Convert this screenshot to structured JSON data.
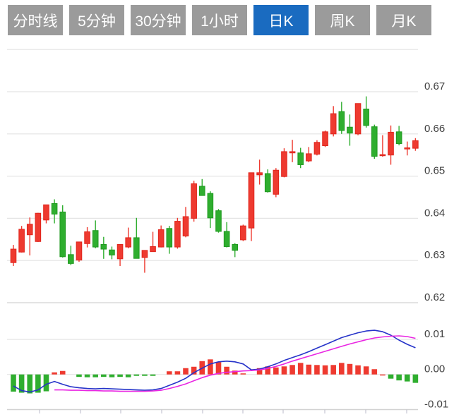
{
  "toolbar": {
    "tabs": [
      {
        "label": "分时线",
        "active": false
      },
      {
        "label": "5分钟",
        "active": false
      },
      {
        "label": "30分钟",
        "active": false
      },
      {
        "label": "1小时",
        "active": false
      },
      {
        "label": "日K",
        "active": true
      },
      {
        "label": "周K",
        "active": false
      },
      {
        "label": "月K",
        "active": false
      }
    ]
  },
  "colors": {
    "up": "#ee3a30",
    "up_border": "#e0251c",
    "down": "#2fae2f",
    "down_border": "#1f9a1f",
    "dif_line": "#2633c9",
    "dea_line": "#e926e2",
    "grid": "#e4e4e4",
    "pane_border": "#d2d2d2",
    "axis_text": "#3f3f3f",
    "tab_bg": "#9b9b9b",
    "tab_active_bg": "#1a6bc0",
    "tab_text": "#ffffff"
  },
  "chart_data": {
    "type": "candlestick+macd",
    "main_chart": {
      "ylabel": "price",
      "ylim": [
        0.618,
        0.68
      ],
      "y_axis_labels": [
        "0.67",
        "0.66",
        "0.65",
        "0.64",
        "0.63",
        "0.62"
      ],
      "y_axis_values": [
        0.67,
        0.66,
        0.65,
        0.64,
        0.63,
        0.62
      ],
      "grid_values_unlabeled": [
        0.68
      ],
      "candles_ochl": [
        [
          0.6295,
          0.6327,
          0.6337,
          0.6287
        ],
        [
          0.632,
          0.6374,
          0.6382,
          0.6319
        ],
        [
          0.6361,
          0.6386,
          0.6402,
          0.6312
        ],
        [
          0.6345,
          0.6412,
          0.6413,
          0.6344
        ],
        [
          0.6396,
          0.6432,
          0.6432,
          0.6388
        ],
        [
          0.6435,
          0.641,
          0.6445,
          0.6388
        ],
        [
          0.6415,
          0.6309,
          0.6431,
          0.6307
        ],
        [
          0.6314,
          0.6293,
          0.6335,
          0.6289
        ],
        [
          0.6301,
          0.6344,
          0.6344,
          0.6297
        ],
        [
          0.634,
          0.6368,
          0.6379,
          0.6331
        ],
        [
          0.6371,
          0.6332,
          0.6395,
          0.6329
        ],
        [
          0.6338,
          0.6327,
          0.6356,
          0.6304
        ],
        [
          0.6325,
          0.6313,
          0.6333,
          0.6303
        ],
        [
          0.6304,
          0.6338,
          0.6338,
          0.6287
        ],
        [
          0.6332,
          0.6354,
          0.6378,
          0.6329
        ],
        [
          0.6354,
          0.6305,
          0.6401,
          0.6305
        ],
        [
          0.6307,
          0.6324,
          0.6324,
          0.6271
        ],
        [
          0.6321,
          0.6333,
          0.6368,
          0.6321
        ],
        [
          0.6332,
          0.6373,
          0.6383,
          0.6331
        ],
        [
          0.6376,
          0.6332,
          0.6382,
          0.6316
        ],
        [
          0.6332,
          0.6393,
          0.6401,
          0.6328
        ],
        [
          0.6358,
          0.6404,
          0.6427,
          0.6355
        ],
        [
          0.64,
          0.6482,
          0.6489,
          0.6392
        ],
        [
          0.6476,
          0.6454,
          0.6493,
          0.6454
        ],
        [
          0.6459,
          0.6401,
          0.6464,
          0.6377
        ],
        [
          0.6418,
          0.6369,
          0.6422,
          0.6366
        ],
        [
          0.6369,
          0.6333,
          0.6391,
          0.6331
        ],
        [
          0.6338,
          0.6324,
          0.6341,
          0.6308
        ],
        [
          0.6349,
          0.6382,
          0.6385,
          0.6346
        ],
        [
          0.6377,
          0.6508,
          0.6508,
          0.6346
        ],
        [
          0.6503,
          0.6508,
          0.6539,
          0.648
        ],
        [
          0.6506,
          0.6463,
          0.6516,
          0.6461
        ],
        [
          0.6457,
          0.6514,
          0.6519,
          0.645
        ],
        [
          0.6499,
          0.6558,
          0.6566,
          0.6497
        ],
        [
          0.6555,
          0.6558,
          0.6586,
          0.6533
        ],
        [
          0.6555,
          0.6527,
          0.6567,
          0.6519
        ],
        [
          0.6536,
          0.6553,
          0.6569,
          0.6533
        ],
        [
          0.6552,
          0.658,
          0.6585,
          0.6549
        ],
        [
          0.6572,
          0.6605,
          0.6608,
          0.6569
        ],
        [
          0.66,
          0.6648,
          0.6666,
          0.6594
        ],
        [
          0.6653,
          0.6608,
          0.6676,
          0.66
        ],
        [
          0.6616,
          0.6602,
          0.6646,
          0.6572
        ],
        [
          0.66,
          0.6672,
          0.6672,
          0.6597
        ],
        [
          0.6659,
          0.662,
          0.6689,
          0.6615
        ],
        [
          0.6617,
          0.6547,
          0.6622,
          0.6541
        ],
        [
          0.6549,
          0.6551,
          0.6597,
          0.6546
        ],
        [
          0.655,
          0.6604,
          0.662,
          0.6527
        ],
        [
          0.6605,
          0.6577,
          0.6619,
          0.6573
        ],
        [
          0.6565,
          0.6567,
          0.6582,
          0.6549
        ],
        [
          0.6566,
          0.6584,
          0.659,
          0.656
        ]
      ]
    },
    "macd_panel": {
      "y_axis_labels": [
        "0.01",
        "0.00",
        "-0.01"
      ],
      "y_axis_values": [
        0.01,
        0.0,
        -0.01
      ],
      "histogram": [
        -0.0049,
        -0.0052,
        -0.0054,
        -0.0052,
        -0.0048,
        0.0006,
        0.001,
        0.0,
        -0.0007,
        -0.0008,
        -0.0008,
        -0.0007,
        -0.0008,
        -0.0007,
        -0.0008,
        -0.0004,
        -0.0004,
        -0.0004,
        0.0,
        0.0009,
        0.0009,
        0.0018,
        0.0022,
        0.0038,
        0.0043,
        0.0035,
        0.0022,
        0.0011,
        0.0003,
        0.0,
        0.0018,
        0.0023,
        0.002,
        0.0023,
        0.0027,
        0.0033,
        0.0028,
        0.0027,
        0.0026,
        0.0027,
        0.0033,
        0.003,
        0.0026,
        0.0023,
        0.0015,
        -0.0002,
        -0.0012,
        -0.0017,
        -0.002,
        -0.0024
      ],
      "histogram_colors": [
        "down",
        "down",
        "down",
        "down",
        "down",
        "up",
        "up",
        "none",
        "down",
        "down",
        "down",
        "down",
        "down",
        "down",
        "down",
        "down",
        "down",
        "down",
        "none",
        "up",
        "up",
        "up",
        "up",
        "up",
        "up",
        "up",
        "up",
        "up",
        "up",
        "none",
        "up",
        "up",
        "up",
        "up",
        "up",
        "up",
        "up",
        "up",
        "up",
        "up",
        "up",
        "up",
        "up",
        "up",
        "up",
        "up",
        "down",
        "down",
        "down",
        "down"
      ],
      "dif": [
        -0.0033,
        -0.0046,
        -0.005,
        -0.0044,
        -0.0028,
        -0.002,
        -0.0028,
        -0.0035,
        -0.0038,
        -0.004,
        -0.0041,
        -0.004,
        -0.0041,
        -0.0042,
        -0.0043,
        -0.0044,
        -0.0045,
        -0.0044,
        -0.004,
        -0.0031,
        -0.0022,
        -0.0011,
        0.0005,
        0.0018,
        0.003,
        0.0036,
        0.0038,
        0.0036,
        0.003,
        0.0013,
        0.0015,
        0.0022,
        0.003,
        0.004,
        0.0048,
        0.0056,
        0.0065,
        0.0075,
        0.0085,
        0.0095,
        0.0105,
        0.0112,
        0.0119,
        0.0124,
        0.0126,
        0.0122,
        0.0112,
        0.0098,
        0.0086,
        0.0076
      ],
      "dea": [
        null,
        null,
        null,
        null,
        null,
        -0.0044,
        -0.0044,
        -0.0045,
        -0.0045,
        -0.0046,
        -0.0046,
        -0.0047,
        -0.0047,
        -0.0048,
        -0.0048,
        -0.0048,
        -0.0048,
        -0.0047,
        -0.0045,
        -0.004,
        -0.0034,
        -0.0027,
        -0.0018,
        -0.0009,
        -0.0002,
        0.0003,
        0.0006,
        0.0008,
        0.001,
        0.0011,
        0.0013,
        0.0017,
        0.0023,
        0.003,
        0.0038,
        0.0045,
        0.0052,
        0.0059,
        0.0066,
        0.0073,
        0.008,
        0.0087,
        0.0093,
        0.0099,
        0.0104,
        0.0107,
        0.0109,
        0.011,
        0.0108,
        0.0103
      ]
    }
  }
}
